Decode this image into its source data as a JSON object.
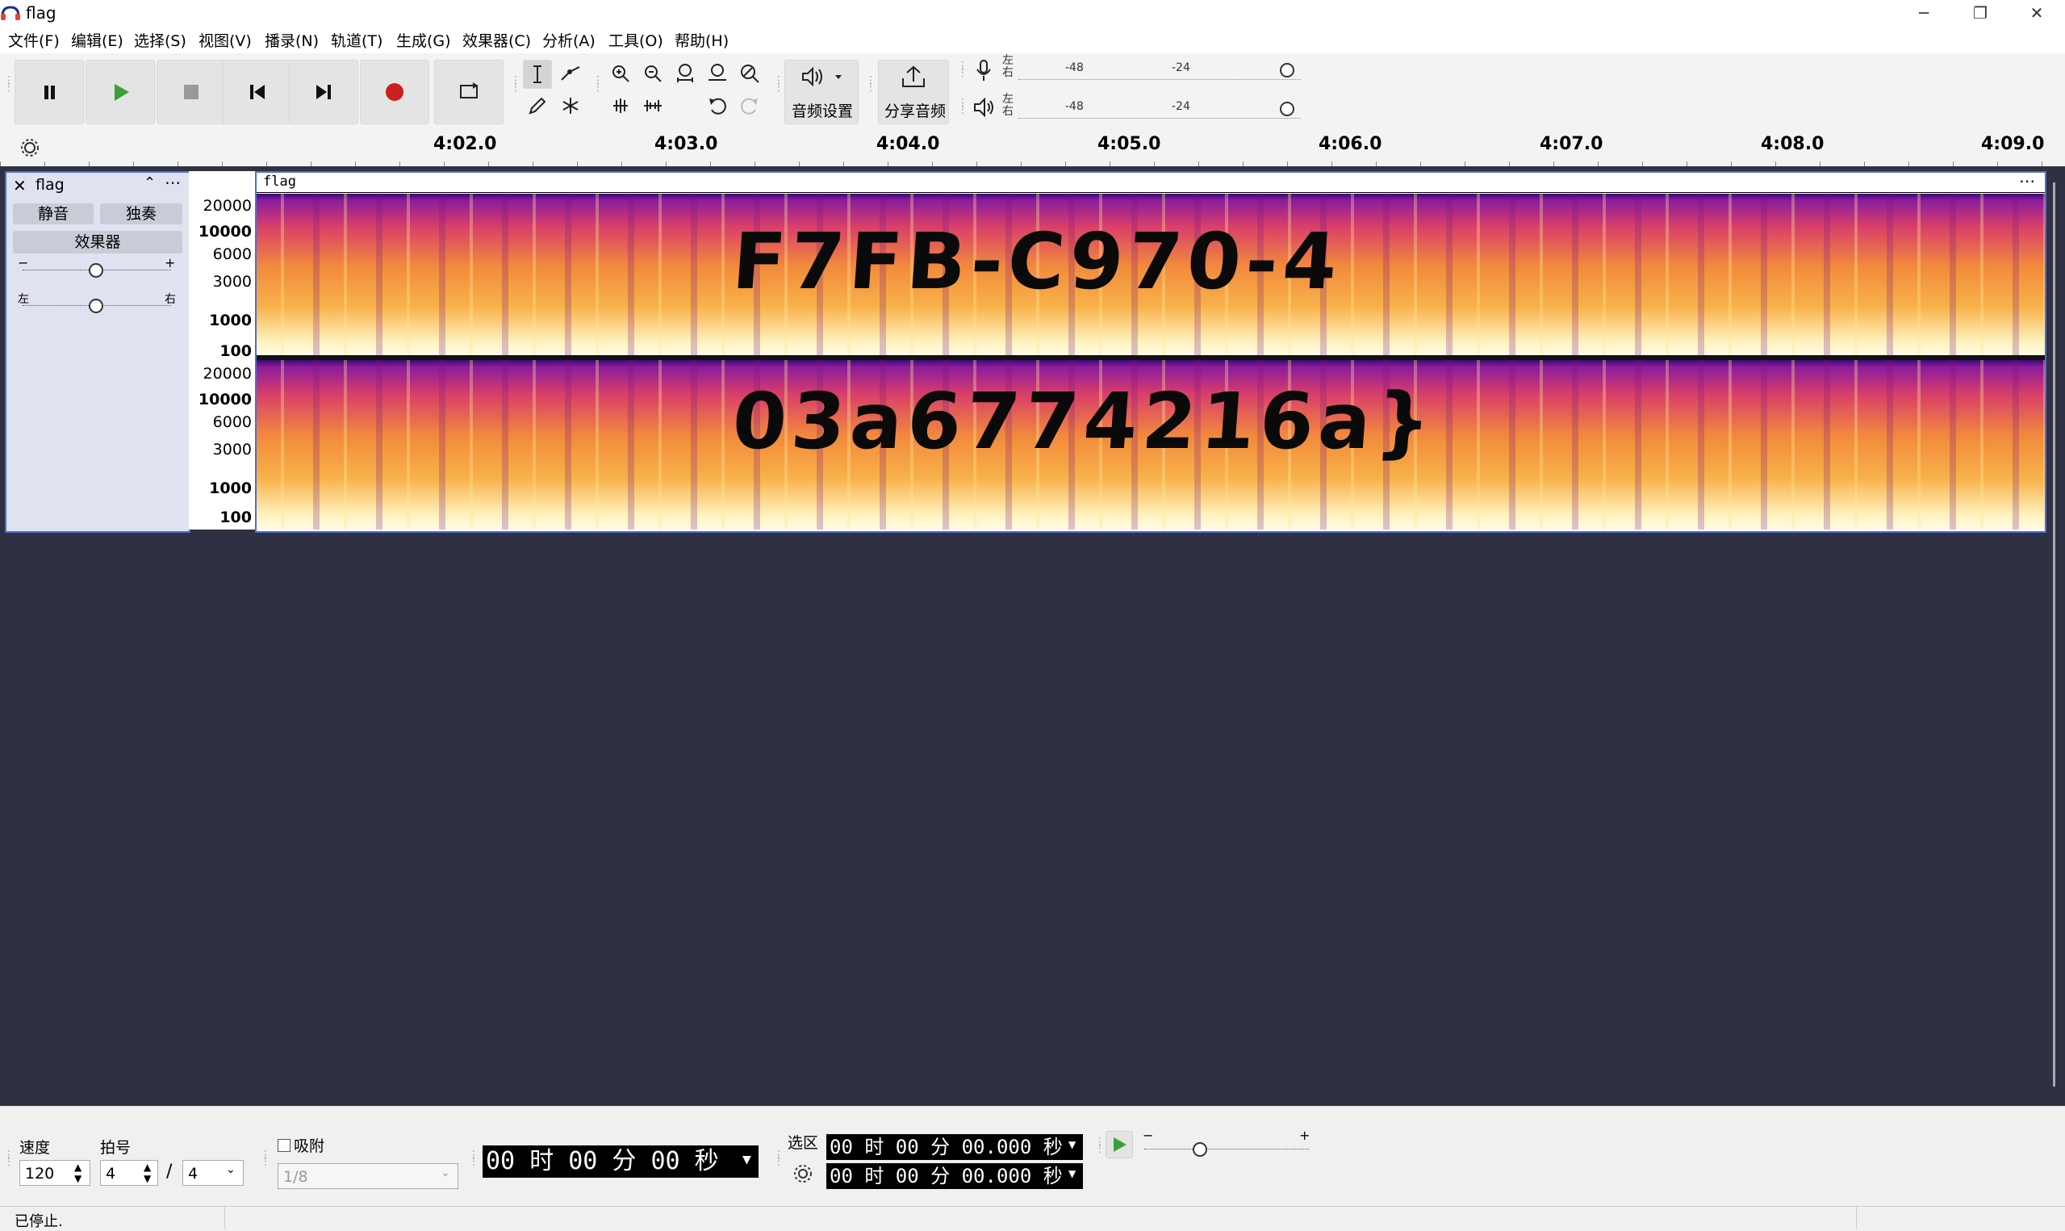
{
  "window": {
    "title": "flag",
    "minimize": "─",
    "restore": "❐",
    "close": "✕"
  },
  "menu": [
    "文件(F)",
    "编辑(E)",
    "选择(S)",
    "视图(V)",
    "播录(N)",
    "轨道(T)",
    "生成(G)",
    "效果器(C)",
    "分析(A)",
    "工具(O)",
    "帮助(H)"
  ],
  "toolbar": {
    "audio_setup_label": "音频设置",
    "share_audio_label": "分享音频",
    "meter_lr": [
      "左",
      "右"
    ],
    "meter_ticks": [
      "-48",
      "-24"
    ]
  },
  "ruler": {
    "ticks": [
      "4:02.0",
      "4:03.0",
      "4:04.0",
      "4:05.0",
      "4:06.0",
      "4:07.0",
      "4:08.0",
      "4:09.0"
    ]
  },
  "track": {
    "name": "flag",
    "clip_name": "flag",
    "mute": "静音",
    "solo": "独奏",
    "effects": "效果器",
    "gain_minus": "−",
    "gain_plus": "+",
    "pan_left": "左",
    "pan_right": "右",
    "freq_labels": [
      "20000",
      "10000",
      "6000",
      "3000",
      "1000",
      "100"
    ],
    "channel1_text": "F7FB-C970-4",
    "channel2_text": "03a6774216a}"
  },
  "bottom": {
    "tempo_label": "速度",
    "tempo_value": "120",
    "meter_label": "拍号",
    "meter_num": "4",
    "meter_slash": "/",
    "meter_den": "4",
    "snap_label": "吸附",
    "snap_value": "1/8",
    "time_display": "00 时 00 分 00 秒",
    "selection_label": "选区",
    "sel_start": "00 时 00 分 00.000 秒",
    "sel_end": "00 时 00 分 00.000 秒",
    "speed_minus": "−",
    "speed_plus": "+"
  },
  "status": {
    "text": "已停止."
  }
}
